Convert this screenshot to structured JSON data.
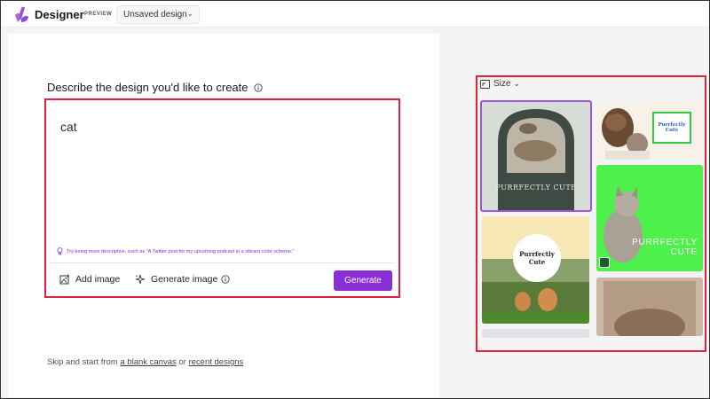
{
  "app": {
    "name": "Designer",
    "badge": "PREVIEW",
    "document_title": "Unsaved design"
  },
  "main": {
    "heading": "Describe the design you'd like to create",
    "prompt_value": "cat",
    "tip": "Try being more descriptive, such as \"A Twitter post for my upcoming podcast in a vibrant color scheme.\"",
    "add_image_label": "Add image",
    "generate_image_label": "Generate image",
    "generate_button_label": "Generate",
    "bottom": {
      "prefix": "Skip and start from",
      "blank_canvas": "a blank canvas",
      "or": "or",
      "recent_designs": "recent designs"
    }
  },
  "gallery": {
    "size_label": "Size",
    "cards": [
      {
        "text": "PURRFECTLY CUTE"
      },
      {
        "line1": "Purrfectly",
        "line2": "Cute"
      },
      {
        "line1": "PURRFECTLY",
        "line2": "CUTE"
      },
      {
        "line1": "Purrfectly",
        "line2": "Cute"
      }
    ]
  },
  "colors": {
    "accent": "#8a2ed6",
    "highlight": "#e0223c",
    "tip": "#8a2be2"
  }
}
